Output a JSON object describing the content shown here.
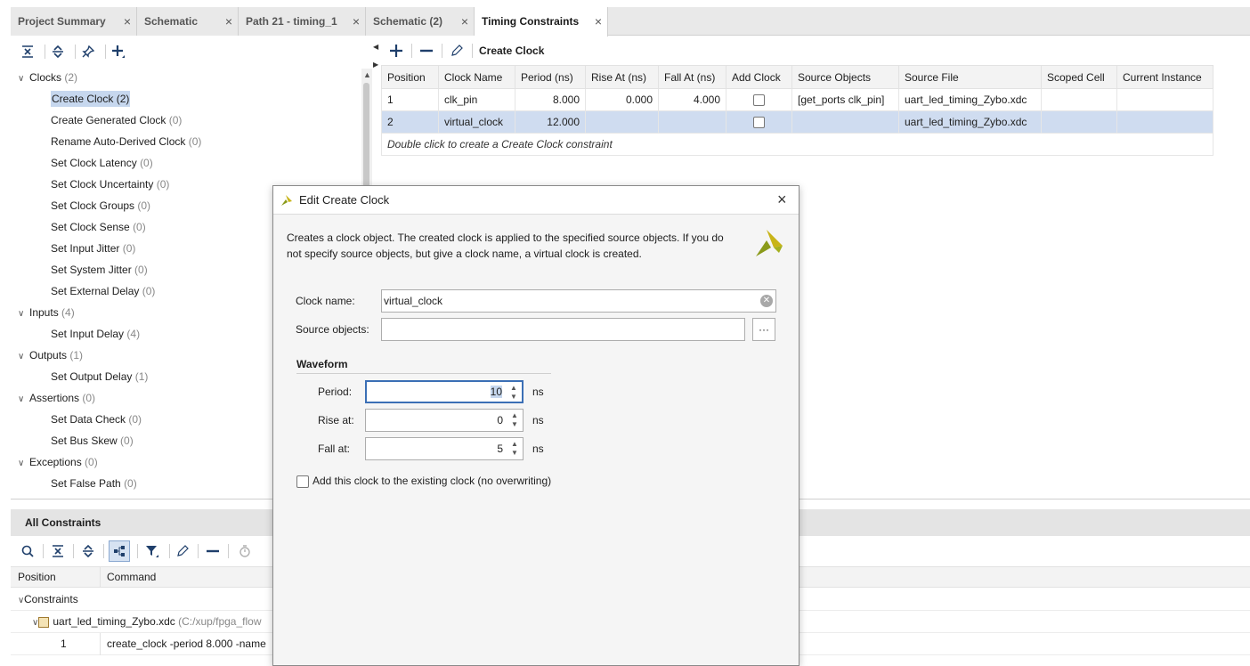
{
  "tabs": [
    {
      "label": "Project Summary"
    },
    {
      "label": "Schematic"
    },
    {
      "label": "Path 21 - timing_1"
    },
    {
      "label": "Schematic (2)"
    },
    {
      "label": "Timing Constraints"
    }
  ],
  "close_glyph": "×",
  "tree": {
    "groups": [
      {
        "label": "Clocks",
        "count": "(2)",
        "items": [
          {
            "label": "Create Clock",
            "count": "(2)"
          },
          {
            "label": "Create Generated Clock",
            "count": "(0)"
          },
          {
            "label": "Rename Auto-Derived Clock",
            "count": "(0)"
          },
          {
            "label": "Set Clock Latency",
            "count": "(0)"
          },
          {
            "label": "Set Clock Uncertainty",
            "count": "(0)"
          },
          {
            "label": "Set Clock Groups",
            "count": "(0)"
          },
          {
            "label": "Set Clock Sense",
            "count": "(0)"
          },
          {
            "label": "Set Input Jitter",
            "count": "(0)"
          },
          {
            "label": "Set System Jitter",
            "count": "(0)"
          },
          {
            "label": "Set External Delay",
            "count": "(0)"
          }
        ]
      },
      {
        "label": "Inputs",
        "count": "(4)",
        "items": [
          {
            "label": "Set Input Delay",
            "count": "(4)"
          }
        ]
      },
      {
        "label": "Outputs",
        "count": "(1)",
        "items": [
          {
            "label": "Set Output Delay",
            "count": "(1)"
          }
        ]
      },
      {
        "label": "Assertions",
        "count": "(0)",
        "items": [
          {
            "label": "Set Data Check",
            "count": "(0)"
          },
          {
            "label": "Set Bus Skew",
            "count": "(0)"
          }
        ]
      },
      {
        "label": "Exceptions",
        "count": "(0)",
        "items": [
          {
            "label": "Set False Path",
            "count": "(0)"
          }
        ]
      }
    ]
  },
  "right_toolbar": {
    "title": "Create Clock"
  },
  "grid": {
    "columns": [
      "Position",
      "Clock Name",
      "Period (ns)",
      "Rise At (ns)",
      "Fall At (ns)",
      "Add Clock",
      "Source Objects",
      "Source File",
      "Scoped Cell",
      "Current Instance"
    ],
    "rows": [
      {
        "position": "1",
        "clock_name": "clk_pin",
        "period": "8.000",
        "rise": "0.000",
        "fall": "4.000",
        "source_objects": "[get_ports clk_pin]",
        "source_file": "uart_led_timing_Zybo.xdc",
        "scoped_cell": "",
        "current_instance": ""
      },
      {
        "position": "2",
        "clock_name": "virtual_clock",
        "period": "12.000",
        "rise": "",
        "fall": "",
        "source_objects": "",
        "source_file": "uart_led_timing_Zybo.xdc",
        "scoped_cell": "",
        "current_instance": ""
      }
    ],
    "hint": "Double click to create a Create Clock constraint"
  },
  "all_constraints": {
    "title": "All Constraints",
    "columns": [
      "Position",
      "Command"
    ],
    "root_label": "Constraints",
    "file_label": "uart_led_timing_Zybo.xdc",
    "file_path": "(C:/xup/fpga_flow",
    "row1_position": "1",
    "row1_command": "create_clock -period 8.000 -name"
  },
  "dialog": {
    "title": "Edit Create Clock",
    "description": "Creates a clock object. The created clock is applied to the specified source objects. If you do not specify source objects, but give a clock name, a virtual clock is created.",
    "clock_name_label": "Clock name:",
    "clock_name_value": "virtual_clock",
    "source_objects_label": "Source objects:",
    "source_objects_value": "",
    "browse_label": "···",
    "waveform_label": "Waveform",
    "period_label": "Period:",
    "period_value": "10",
    "rise_label": "Rise at:",
    "rise_value": "0",
    "fall_label": "Fall at:",
    "fall_value": "5",
    "unit": "ns",
    "add_clock_label": "Add this clock to the existing clock (no overwriting)"
  },
  "colors": {
    "accent": "#3b6fb5",
    "selection": "#cfdcf0",
    "logo": "#8a9a1a"
  }
}
